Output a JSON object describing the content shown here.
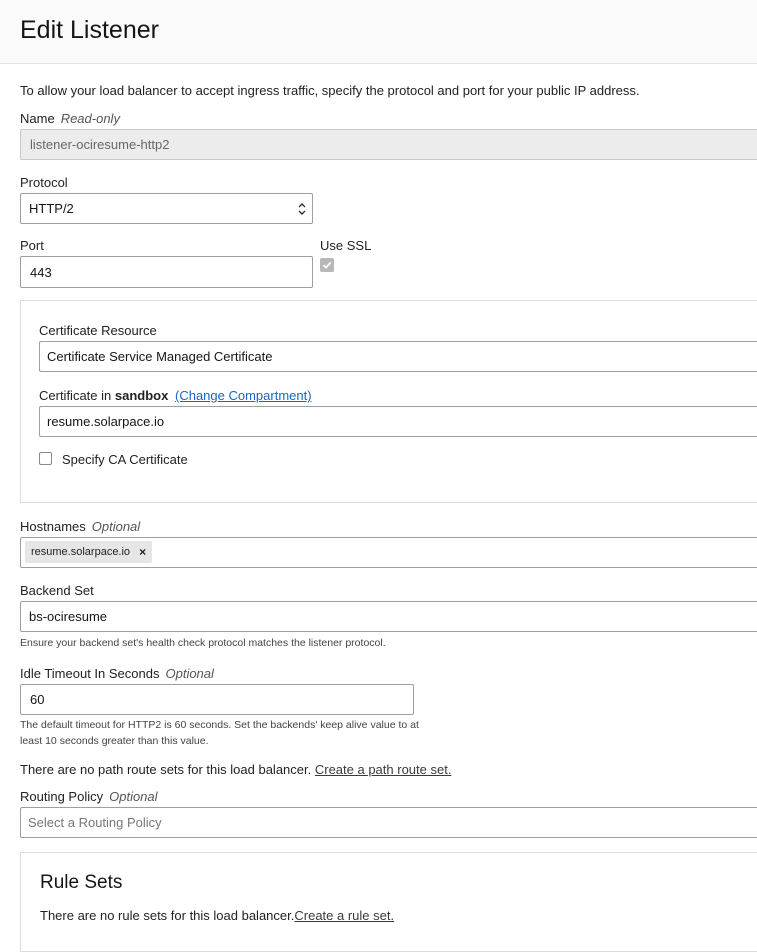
{
  "header": {
    "title": "Edit Listener"
  },
  "intro": "To allow your load balancer to accept ingress traffic, specify the protocol and port for your public IP address.",
  "name": {
    "label": "Name",
    "badge": "Read-only",
    "value": "listener-ociresume-http2"
  },
  "protocol": {
    "label": "Protocol",
    "value": "HTTP/2"
  },
  "port": {
    "label": "Port",
    "value": "443"
  },
  "ssl": {
    "label": "Use SSL",
    "checked": true
  },
  "certificate": {
    "resource_label": "Certificate Resource",
    "resource_value": "Certificate Service Managed Certificate",
    "in_label": "Certificate in",
    "compartment": "sandbox",
    "change_link": "(Change Compartment)",
    "value": "resume.solarpace.io",
    "ca_label": "Specify CA Certificate",
    "ca_checked": false
  },
  "hostnames": {
    "label": "Hostnames",
    "badge": "Optional",
    "chips": [
      "resume.solarpace.io"
    ],
    "remove_icon": "×"
  },
  "backend_set": {
    "label": "Backend Set",
    "value": "bs-ociresume",
    "help": "Ensure your backend set's health check protocol matches the listener protocol."
  },
  "idle_timeout": {
    "label": "Idle Timeout In Seconds",
    "badge": "Optional",
    "value": "60",
    "help_line1": "The default timeout for HTTP2 is 60 seconds. Set the backends' keep alive value to at",
    "help_line2": "least 10 seconds greater than this value."
  },
  "path_route": {
    "text": "There are no path route sets for this load balancer.",
    "link": "Create a path route set."
  },
  "routing_policy": {
    "label": "Routing Policy",
    "badge": "Optional",
    "placeholder": "Select a Routing Policy"
  },
  "rule_sets": {
    "title": "Rule Sets",
    "text": "There are no rule sets for this load balancer.",
    "link": "Create a rule set."
  },
  "colors": {
    "link": "#1a66c2",
    "readonly_bg": "#ececec",
    "checkbox_checked": "#b8b8b8"
  }
}
